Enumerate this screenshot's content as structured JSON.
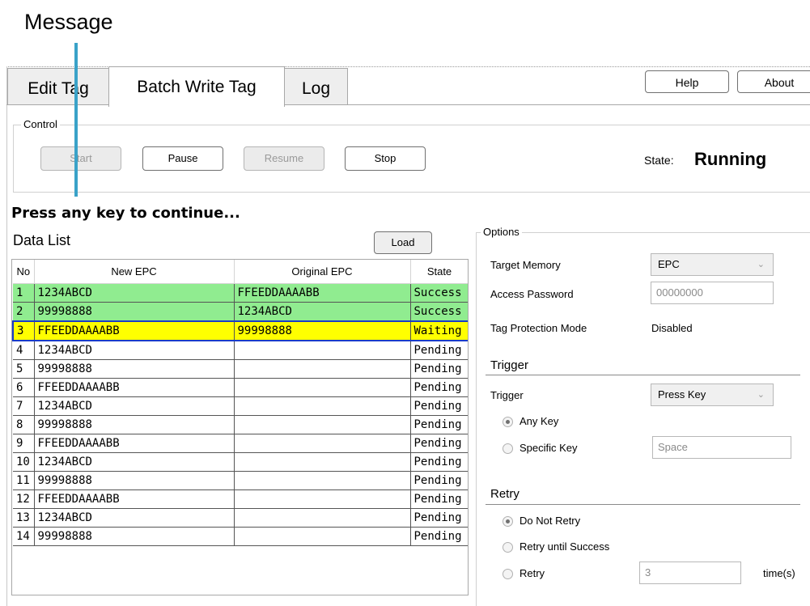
{
  "annotation": {
    "label": "Message"
  },
  "tabs": [
    {
      "label": "Edit Tag"
    },
    {
      "label": "Batch Write Tag"
    },
    {
      "label": "Log"
    }
  ],
  "header_buttons": {
    "help": "Help",
    "about": "About"
  },
  "control": {
    "legend": "Control",
    "start": "Start",
    "pause": "Pause",
    "resume": "Resume",
    "stop": "Stop",
    "state_label": "State:",
    "state_value": "Running"
  },
  "message": "Press any key to continue...",
  "data_list": {
    "title": "Data List",
    "load": "Load",
    "columns": [
      "No",
      "New EPC",
      "Original EPC",
      "State"
    ],
    "rows": [
      {
        "no": "1",
        "new_epc": "1234ABCD",
        "original_epc": "FFEEDDAAAABB",
        "state": "Success"
      },
      {
        "no": "2",
        "new_epc": "99998888",
        "original_epc": "1234ABCD",
        "state": "Success"
      },
      {
        "no": "3",
        "new_epc": "FFEEDDAAAABB",
        "original_epc": "99998888",
        "state": "Waiting"
      },
      {
        "no": "4",
        "new_epc": "1234ABCD",
        "original_epc": "",
        "state": "Pending"
      },
      {
        "no": "5",
        "new_epc": "99998888",
        "original_epc": "",
        "state": "Pending"
      },
      {
        "no": "6",
        "new_epc": "FFEEDDAAAABB",
        "original_epc": "",
        "state": "Pending"
      },
      {
        "no": "7",
        "new_epc": "1234ABCD",
        "original_epc": "",
        "state": "Pending"
      },
      {
        "no": "8",
        "new_epc": "99998888",
        "original_epc": "",
        "state": "Pending"
      },
      {
        "no": "9",
        "new_epc": "FFEEDDAAAABB",
        "original_epc": "",
        "state": "Pending"
      },
      {
        "no": "10",
        "new_epc": "1234ABCD",
        "original_epc": "",
        "state": "Pending"
      },
      {
        "no": "11",
        "new_epc": "99998888",
        "original_epc": "",
        "state": "Pending"
      },
      {
        "no": "12",
        "new_epc": "FFEEDDAAAABB",
        "original_epc": "",
        "state": "Pending"
      },
      {
        "no": "13",
        "new_epc": "1234ABCD",
        "original_epc": "",
        "state": "Pending"
      },
      {
        "no": "14",
        "new_epc": "99998888",
        "original_epc": "",
        "state": "Pending"
      }
    ]
  },
  "options": {
    "legend": "Options",
    "target_memory_label": "Target Memory",
    "target_memory_value": "EPC",
    "access_password_label": "Access Password",
    "access_password_value": "00000000",
    "tag_protection_label": "Tag Protection Mode",
    "tag_protection_value": "Disabled"
  },
  "trigger": {
    "section_title": "Trigger",
    "label": "Trigger",
    "value": "Press Key",
    "any_key": "Any Key",
    "specific_key": "Specific Key",
    "specific_key_value": "Space",
    "selected": "any_key"
  },
  "retry": {
    "section_title": "Retry",
    "do_not_retry": "Do Not Retry",
    "retry_until_success": "Retry until Success",
    "retry": "Retry",
    "retry_count": "3",
    "times_label": "time(s)",
    "selected": "do_not_retry"
  },
  "colors": {
    "success_row": "#90ec90",
    "waiting_row": "#ffff00",
    "selection_border": "#1a3cc8",
    "annotation_line": "#3aa2c8"
  }
}
